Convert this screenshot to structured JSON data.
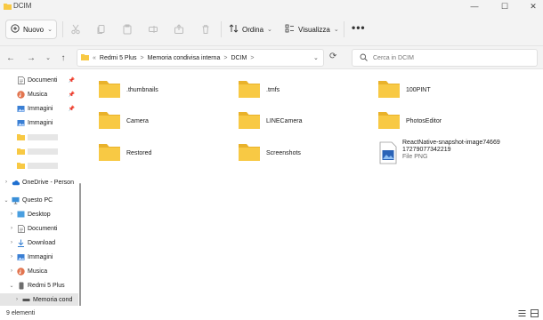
{
  "window": {
    "title": "DCIM",
    "controls": {
      "minimize": "—",
      "maximize": "☐",
      "close": "✕"
    }
  },
  "toolbar": {
    "new_label": "Nuovo",
    "sort_label": "Ordina",
    "view_label": "Visualizza",
    "more_label": "•••",
    "icons": [
      "cut-icon",
      "copy-icon",
      "paste-icon",
      "share-icon",
      "delete-icon"
    ]
  },
  "address": {
    "overflow": "«",
    "crumbs": [
      "Redmi 5 Plus",
      "Memoria condivisa interna",
      "DCIM"
    ],
    "separator": ">",
    "search_placeholder": "Cerca in DCIM"
  },
  "sidebar": {
    "quick_access": [
      {
        "label": "Documenti",
        "icon": "documents-icon",
        "pinned": true
      },
      {
        "label": "Musica",
        "icon": "music-icon",
        "pinned": true
      },
      {
        "label": "Immagini",
        "icon": "pictures-icon",
        "pinned": true
      },
      {
        "label": "Immagini",
        "icon": "pictures-icon",
        "pinned": false
      }
    ],
    "hidden_folders_count": 3,
    "onedrive": "OneDrive - Person",
    "this_pc": "Questo PC",
    "pc_items": [
      {
        "label": "Desktop",
        "icon": "desktop-icon"
      },
      {
        "label": "Documenti",
        "icon": "documents-icon"
      },
      {
        "label": "Download",
        "icon": "download-icon"
      },
      {
        "label": "Immagini",
        "icon": "pictures-icon"
      },
      {
        "label": "Musica",
        "icon": "music-icon"
      }
    ],
    "device": "Redmi 5 Plus",
    "device_storage": "Memoria cond"
  },
  "files": [
    {
      "name": ".thumbnails",
      "type": "folder"
    },
    {
      "name": ".tmfs",
      "type": "folder"
    },
    {
      "name": "100PINT",
      "type": "folder"
    },
    {
      "name": "Camera",
      "type": "folder"
    },
    {
      "name": "LINECamera",
      "type": "folder"
    },
    {
      "name": "PhotosEditor",
      "type": "folder"
    },
    {
      "name": "Restored",
      "type": "folder"
    },
    {
      "name": "Screenshots",
      "type": "folder"
    },
    {
      "name": "ReactNative-snapshot-image74669",
      "name_line2": "17279077342219",
      "subtitle": "File PNG",
      "type": "png"
    }
  ],
  "status": {
    "item_count": "9 elementi"
  },
  "colors": {
    "folder": "#f8c944",
    "folder_dark": "#e9b22b",
    "accent": "#0067c0"
  }
}
